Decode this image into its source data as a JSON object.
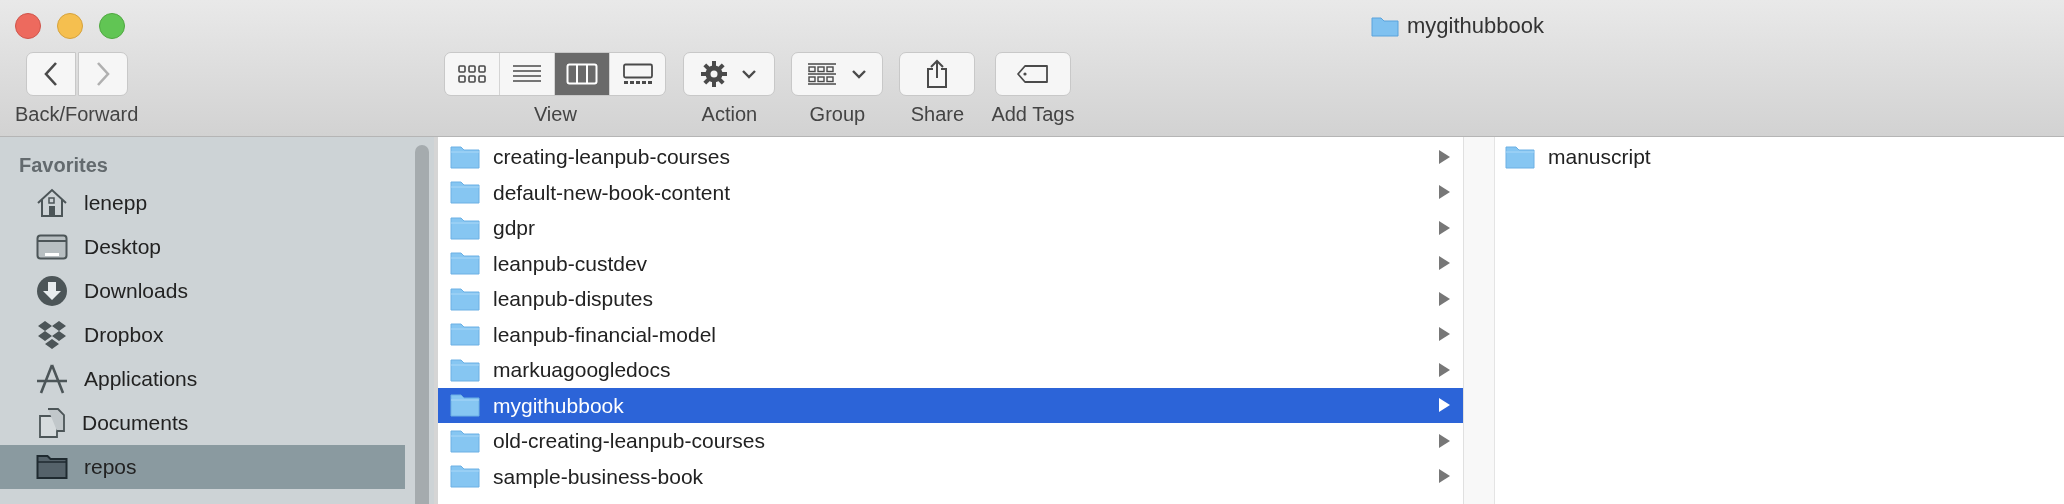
{
  "window": {
    "title": "mygithubbook"
  },
  "toolbar": {
    "navigation": {
      "label": "Back/Forward",
      "back": {
        "disabled": false
      },
      "forward": {
        "disabled": true
      }
    },
    "view": {
      "label": "View",
      "modes": [
        {
          "kind": "icons",
          "selected": false
        },
        {
          "kind": "list",
          "selected": false
        },
        {
          "kind": "columns",
          "selected": true
        },
        {
          "kind": "gallery",
          "selected": false
        }
      ]
    },
    "action": {
      "label": "Action"
    },
    "group": {
      "label": "Group"
    },
    "share": {
      "label": "Share"
    },
    "tags": {
      "label": "Add Tags"
    }
  },
  "sidebar": {
    "section": "Favorites",
    "items": [
      {
        "kind": "home",
        "label": "lenepp",
        "selected": false
      },
      {
        "kind": "desktop",
        "label": "Desktop",
        "selected": false
      },
      {
        "kind": "downloads",
        "label": "Downloads",
        "selected": false
      },
      {
        "kind": "dropbox",
        "label": "Dropbox",
        "selected": false
      },
      {
        "kind": "applications",
        "label": "Applications",
        "selected": false
      },
      {
        "kind": "documents",
        "label": "Documents",
        "selected": false
      },
      {
        "kind": "folder",
        "label": "repos",
        "selected": true
      }
    ]
  },
  "columns": [
    {
      "items": [
        {
          "name": "creating-leanpub-courses",
          "selected": false
        },
        {
          "name": "default-new-book-content",
          "selected": false
        },
        {
          "name": "gdpr",
          "selected": false
        },
        {
          "name": "leanpub-custdev",
          "selected": false
        },
        {
          "name": "leanpub-disputes",
          "selected": false
        },
        {
          "name": "leanpub-financial-model",
          "selected": false
        },
        {
          "name": "markuagoogledocs",
          "selected": false
        },
        {
          "name": "mygithubbook",
          "selected": true
        },
        {
          "name": "old-creating-leanpub-courses",
          "selected": false
        },
        {
          "name": "sample-business-book",
          "selected": false
        }
      ]
    },
    {
      "items": [
        {
          "name": "manuscript",
          "selected": false
        }
      ]
    }
  ]
}
